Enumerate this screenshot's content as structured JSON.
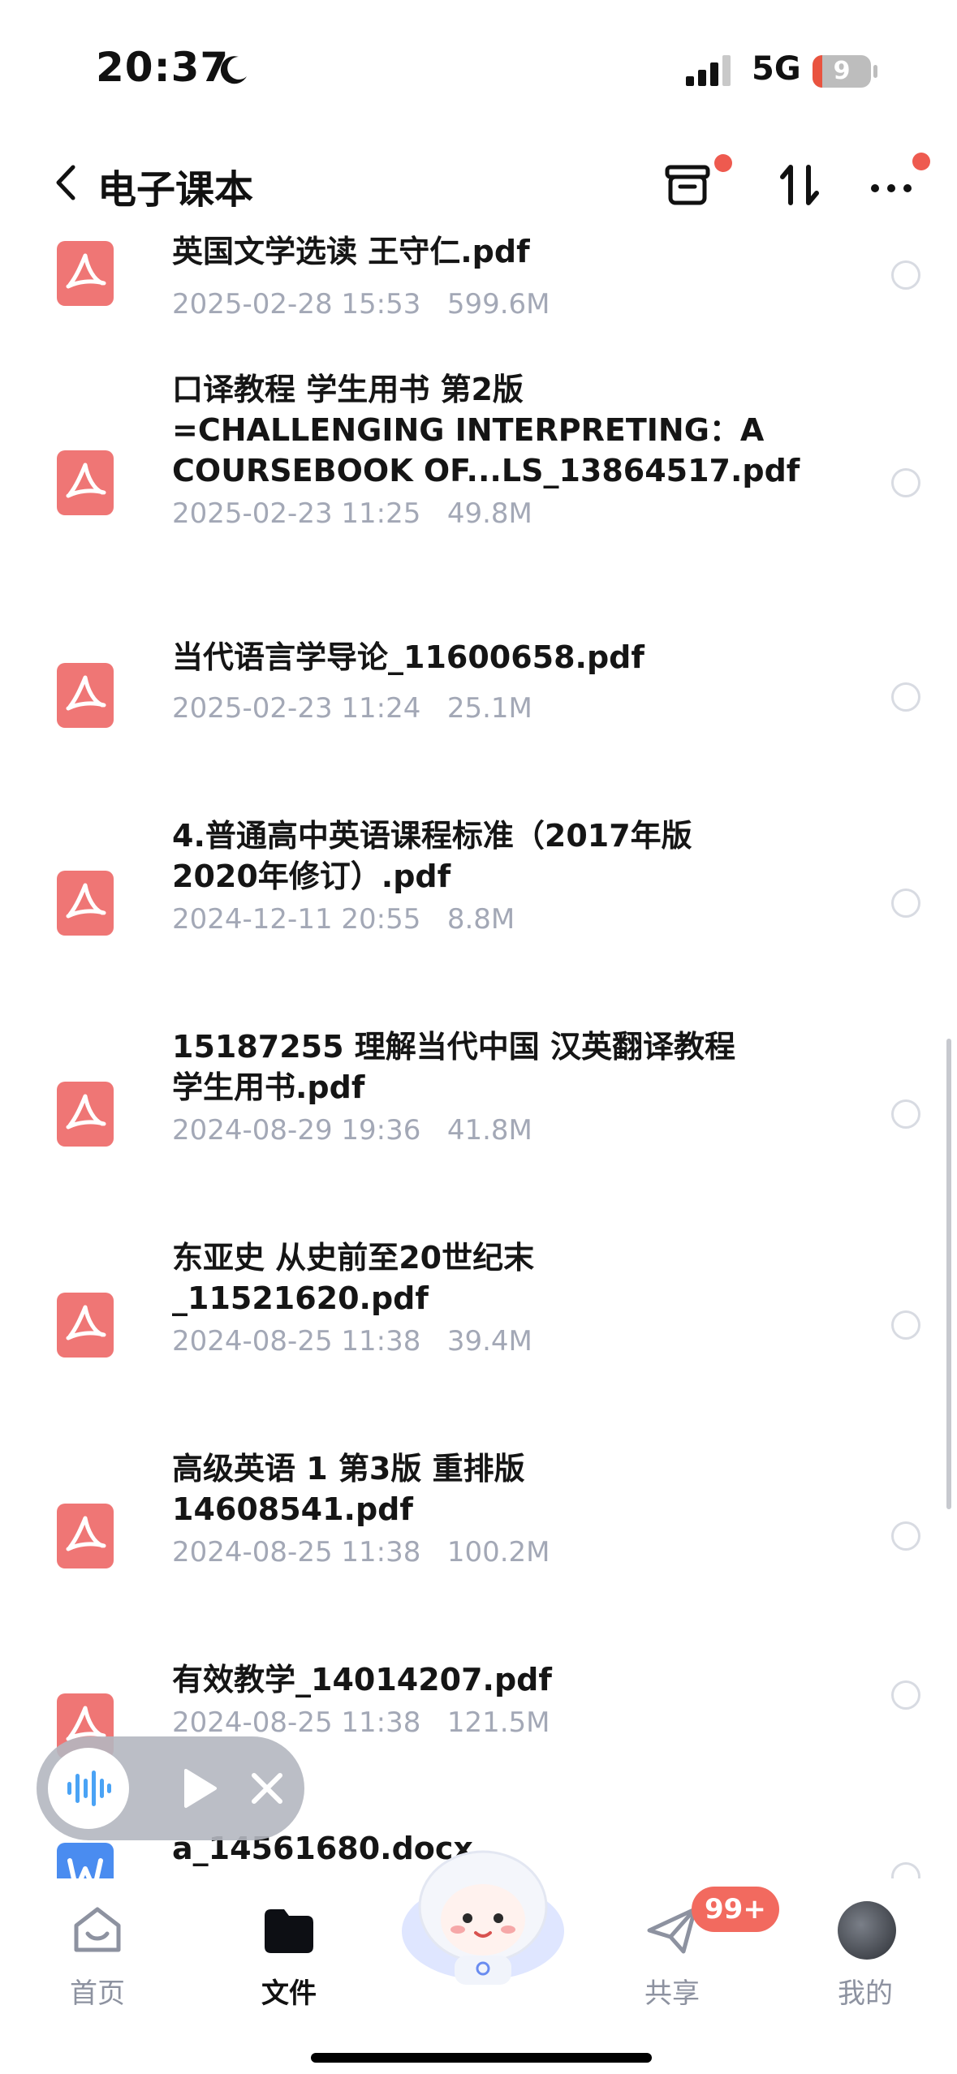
{
  "status": {
    "time": "20:37",
    "network": "5G",
    "battery_level": "9"
  },
  "header": {
    "title": "电子课本"
  },
  "files": [
    {
      "name": "英国文学选读 王守仁.pdf",
      "date": "2025-02-28 15:53",
      "size": "599.6M",
      "type": "pdf"
    },
    {
      "name": "口译教程  学生用书  第2版\n=CHALLENGING INTERPRETING：A\nCOURSEBOOK OF...LS_13864517.pdf",
      "date": "2025-02-23 11:25",
      "size": "49.8M",
      "type": "pdf"
    },
    {
      "name": "当代语言学导论_11600658.pdf",
      "date": "2025-02-23 11:24",
      "size": "25.1M",
      "type": "pdf"
    },
    {
      "name": "4.普通高中英语课程标准（2017年版\n2020年修订）.pdf",
      "date": "2024-12-11 20:55",
      "size": "8.8M",
      "type": "pdf"
    },
    {
      "name": "15187255 理解当代中国 汉英翻译教程\n学生用书.pdf",
      "date": "2024-08-29 19:36",
      "size": "41.8M",
      "type": "pdf"
    },
    {
      "name": "东亚史  从史前至20世纪末\n_11521620.pdf",
      "date": "2024-08-25 11:38",
      "size": "39.4M",
      "type": "pdf"
    },
    {
      "name": "高级英语  1  第3版  重排版\n14608541.pdf",
      "date": "2024-08-25 11:38",
      "size": "100.2M",
      "type": "pdf"
    },
    {
      "name": "有效教学_14014207.pdf",
      "date": "2024-08-25 11:38",
      "size": "121.5M",
      "type": "pdf"
    },
    {
      "name": "a_14561680.docx",
      "date": "",
      "size": "",
      "type": "docx"
    }
  ],
  "nav": {
    "home": "首页",
    "files": "文件",
    "share": "共享",
    "share_badge": "99+",
    "me": "我的"
  },
  "colors": {
    "pdf": "#ef7675",
    "docx": "#4a8cf0",
    "badge": "#f26a5f",
    "dot": "#ee5a4f"
  }
}
